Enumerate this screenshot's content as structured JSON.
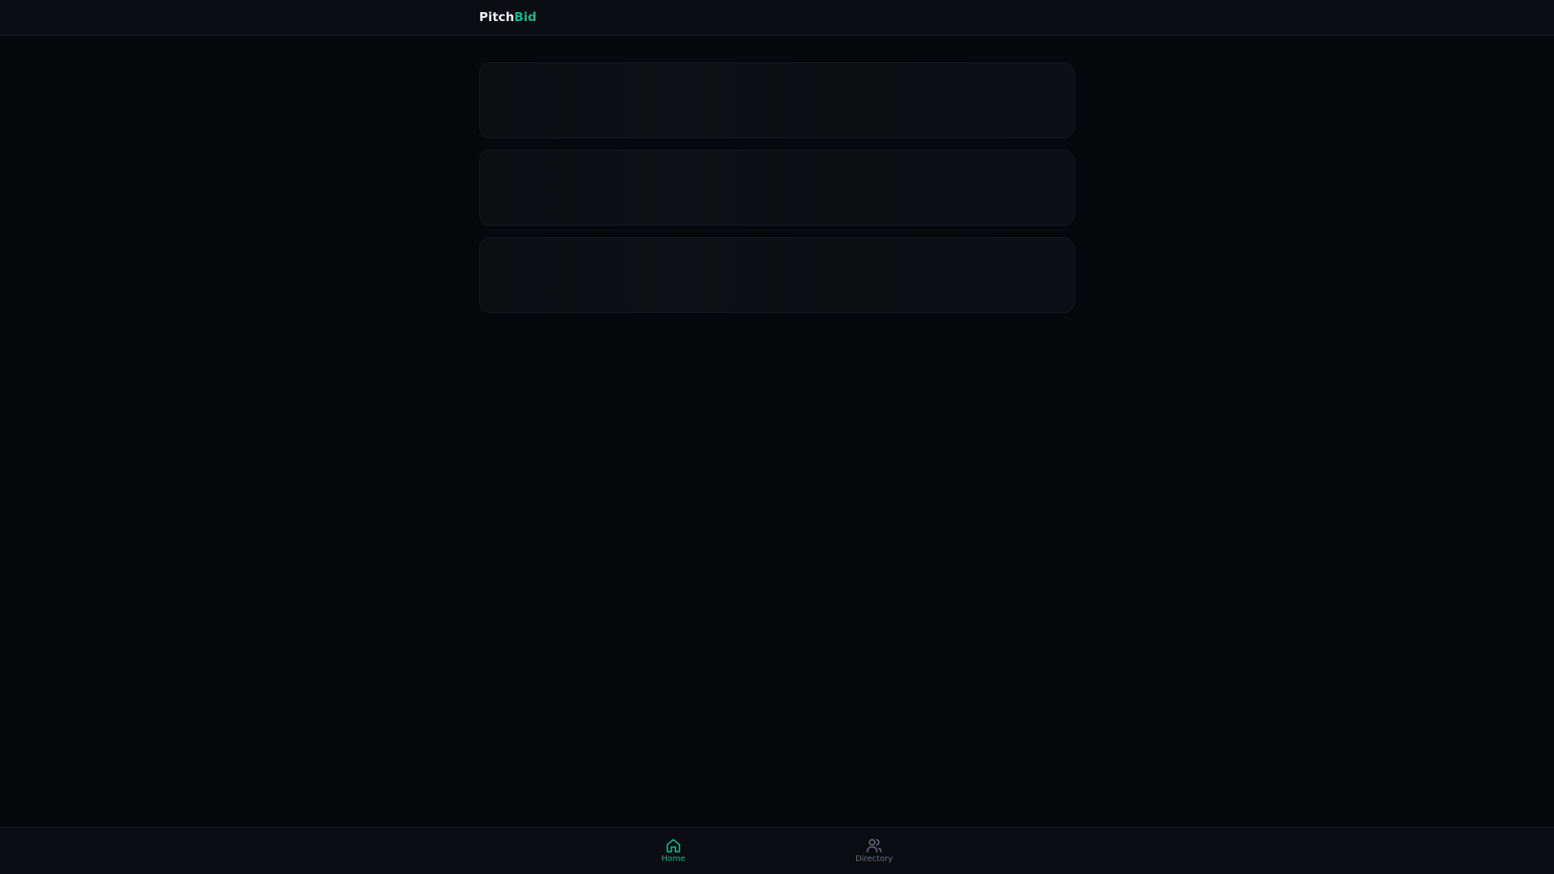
{
  "header": {
    "brand_part1": "Pitch",
    "brand_part2": "Bid"
  },
  "main": {
    "loading_cards": 3
  },
  "bottom_nav": {
    "items": [
      {
        "label": "Home",
        "icon": "home-icon",
        "active": true
      },
      {
        "label": "Directory",
        "icon": "users-icon",
        "active": false
      }
    ]
  },
  "colors": {
    "accent": "#17b890",
    "background": "#07080b",
    "bar": "#0b0d12",
    "muted": "#6b7280"
  }
}
